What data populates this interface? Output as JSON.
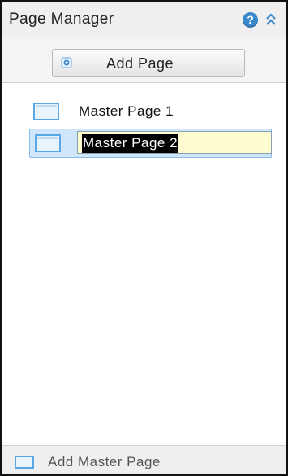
{
  "header": {
    "title": "Page Manager",
    "help_icon": "help-icon",
    "collapse_icon": "double-chevron-up-icon"
  },
  "toolbar": {
    "add_page_label": "Add Page",
    "add_page_icon": "add-page-icon"
  },
  "pages": [
    {
      "label": "Master Page 1",
      "icon": "page-icon",
      "selected": false
    },
    {
      "label": "Master Page 2",
      "icon": "page-icon",
      "selected": true,
      "editing": true
    }
  ],
  "footer": {
    "add_master_page_label": "Add Master Page",
    "icon": "page-icon"
  },
  "colors": {
    "accent": "#3a87c9",
    "selection_bg": "#cfe6fb",
    "input_bg": "#fffbd0"
  }
}
